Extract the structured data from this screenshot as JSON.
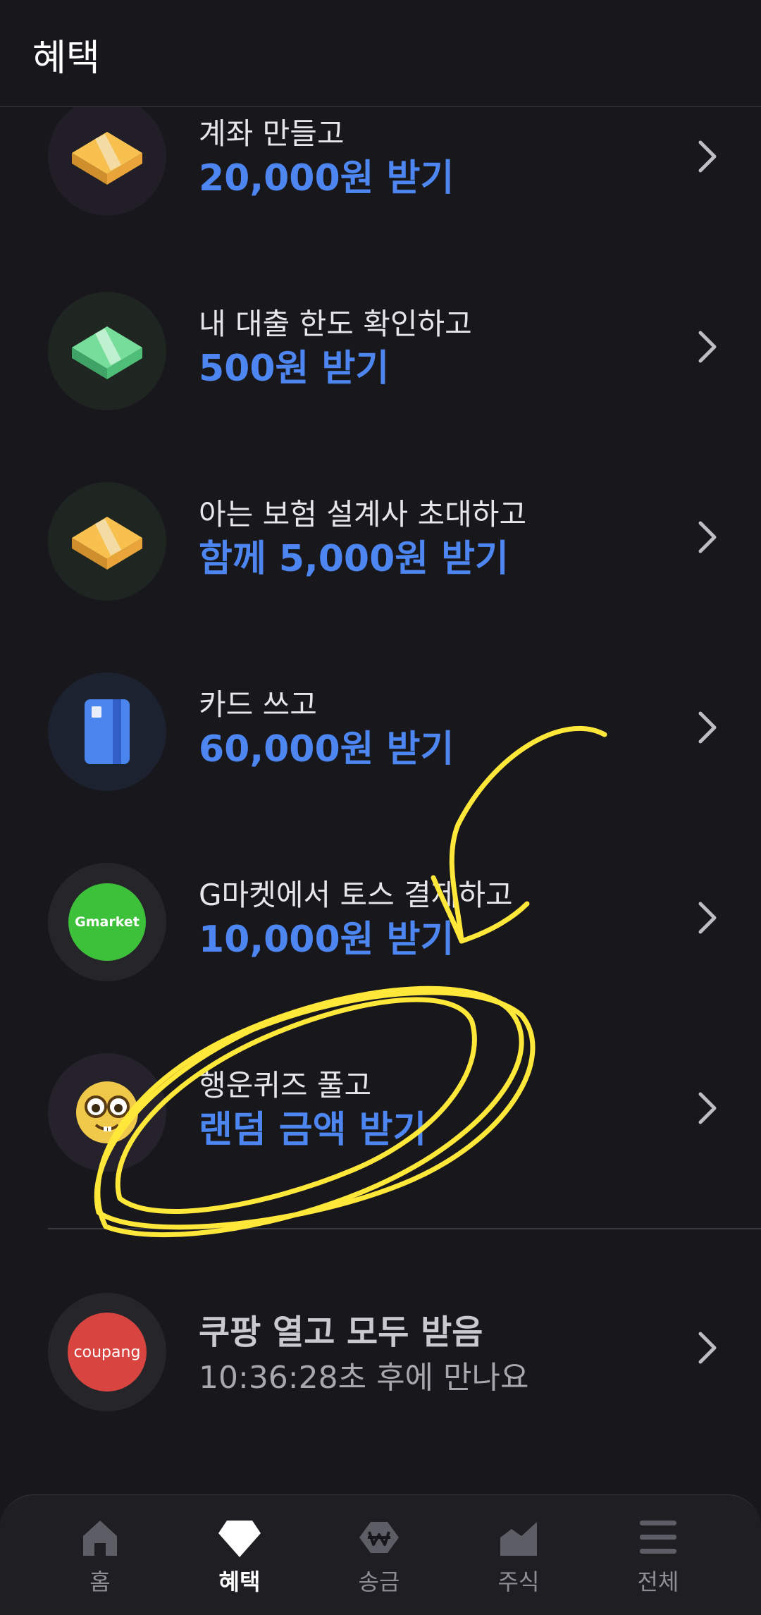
{
  "header": {
    "title": "혜택"
  },
  "benefits": [
    {
      "line1": "계좌 만들고",
      "line2": "20,000원 받기",
      "icon": "money-stack-yellow-icon"
    },
    {
      "line1": "내 대출 한도 확인하고",
      "line2": "500원 받기",
      "icon": "money-stack-green-icon"
    },
    {
      "line1": "아는 보험 설계사 초대하고",
      "line2": "함께 5,000원 받기",
      "icon": "money-stack-yellow-icon"
    },
    {
      "line1": "카드 쓰고",
      "line2": "60,000원 받기",
      "icon": "card-icon"
    },
    {
      "line1": "G마켓에서 토스 결제하고",
      "line2": "10,000원 받기",
      "icon": "gmarket-logo-icon",
      "logo_text": "Gmarket"
    },
    {
      "line1": "행운퀴즈 풀고",
      "line2": "랜덤 금액 받기",
      "icon": "nerd-face-icon"
    }
  ],
  "coupang": {
    "line1": "쿠팡 열고 모두 받음",
    "line2": "10:36:28초 후에 만나요",
    "logo_text": "coupang",
    "icon": "coupang-logo-icon"
  },
  "nav": [
    {
      "label": "홈",
      "icon": "home-icon",
      "active": false
    },
    {
      "label": "혜택",
      "icon": "diamond-icon",
      "active": true
    },
    {
      "label": "송금",
      "icon": "won-icon",
      "active": false
    },
    {
      "label": "주식",
      "icon": "chart-icon",
      "active": false
    },
    {
      "label": "전체",
      "icon": "menu-icon",
      "active": false
    }
  ],
  "colors": {
    "background": "#18181c",
    "accent": "#4d86f0",
    "annotation": "#ffe83a",
    "coupang": "#d8443f",
    "gmarket": "#3ec13a"
  }
}
